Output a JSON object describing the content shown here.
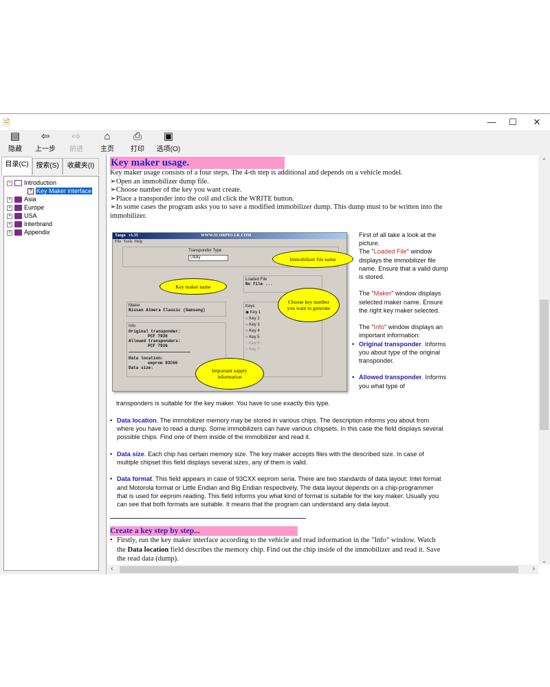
{
  "window": {
    "minimize": "—",
    "maximize": "☐",
    "close": "✕"
  },
  "toolbar": [
    {
      "label": "隐藏",
      "icon": "hide-icon",
      "glyph": "▤"
    },
    {
      "label": "上一步",
      "icon": "back-arrow-icon",
      "glyph": "⇦"
    },
    {
      "label": "前进",
      "icon": "forward-arrow-icon",
      "glyph": "⇨",
      "disabled": true
    },
    {
      "label": "主页",
      "icon": "home-icon",
      "glyph": "⌂"
    },
    {
      "label": "打印",
      "icon": "printer-icon",
      "glyph": "⎙"
    },
    {
      "label": "选项(O)",
      "icon": "options-icon",
      "glyph": "▣"
    }
  ],
  "tabs": [
    "目录(C)",
    "搜索(S)",
    "收藏夹(I)"
  ],
  "tree": [
    {
      "label": "Introduction",
      "expanded": true
    },
    {
      "label": "Key Maker interface",
      "selected": true
    },
    {
      "label": "Asia"
    },
    {
      "label": "Europe"
    },
    {
      "label": "USA"
    },
    {
      "label": "Interbrand"
    },
    {
      "label": "Appendix"
    }
  ],
  "content": {
    "title": "Key maker usage.",
    "intro": "Key maker usage consists of a four steps. The 4-th step is additional and depends on a vehicle model.",
    "steps": [
      "Open an immobilizer dump file.",
      "Choose number of the key you want create.",
      "Place a transponder into the coil and click the WRITE button.",
      "In some cases the program asks you to save a modified immobilizer dump. This dump must to be written into the immobilizer."
    ],
    "screenshot": {
      "app": "Tango",
      "version": "v1.35",
      "site": "WWW.SCORPIO-LK.COM",
      "menu": [
        "File",
        "Tools",
        "Help"
      ],
      "transponder_type_label": "Transponder Type",
      "transponder_type_value": "Utility",
      "loaded_file_label": "Loaded File",
      "loaded_file_value": "No file ...",
      "maker_label": "Maker",
      "maker_value": "Nissan Almera Classic (Samsung)",
      "info_label": "Info",
      "info_lines": [
        "Original transponder:",
        "PCF 7936",
        "Allowed transponders:",
        "PCF 7936",
        "Data location:",
        "eeprom 93C66",
        "Data size:"
      ],
      "keys_label": "Keys",
      "keys": [
        "Key 1",
        "Key 2",
        "Key 3",
        "Key 4",
        "Key 5",
        "Key 6",
        "Key 7"
      ],
      "bubbles": [
        "Immobilizer file name",
        "Key maker name",
        "Choose key number you want to generate",
        "Important supply information"
      ]
    },
    "side": {
      "p1": "First of all take a look at the picture.",
      "p2a": "The \"",
      "p2b": "Loaded File",
      "p2c": "\" window displays the immobilizer file name. Ensure that a valid dump is stored.",
      "p3a": "The \"",
      "p3b": "Maker",
      "p3c": "\" window displays selected maker name. Ensure the right key maker selected.",
      "p4a": "The \"",
      "p4b": "Info",
      "p4c": "\" window displays an important information:",
      "b1t": "Original transponder",
      "b1": ". Informs you about type of the original transponder.",
      "b2t": "Allowed transponder",
      "b2": ". Informs you what type of"
    },
    "cont": "transponders is suitable for the key maker. You have to use exactly this type.",
    "bullets": [
      {
        "term": "Data location",
        "text": ". The immobilizer memory may be stored in various chips. The description informs you about from where you have to read a dump. Some immobilizers can have various chipsets. In this case the field displays several possible chips. Find one of them inside of the immobilizer and read it."
      },
      {
        "term": "Data size",
        "text": ". Each chip has certain memory size. The key maker accepts files with the described size. In case of multiple chipset this field displays several sizes, any of them is valid."
      },
      {
        "term": "Data format",
        "text": ". This field appears in case of 93CXX eeprom seria. There are two standards of data layout: Intel format and Motorola format or Little Endian and Big Endian respectively. The data layout depends on a chip-programmer that is used for eeprom reading. This field informs you what kind of format is suitable for the key maker. Usually you can see that both formats are suitable. It means that the program can understand any data layout."
      }
    ],
    "section2": "Create a key step by step...",
    "s2a": "Firstly, run the key maker interface according to the vehicle and read information in the \"Info\" window. Watch the ",
    "s2b": "Data location",
    "s2c": " field describes the memory chip. Find out the chip inside of the immobilizer and read it. Save the read data (dump)."
  },
  "colors": {
    "heading_bg": "#ff99cc",
    "heading_text": "#2222cc",
    "term": "#2222aa",
    "highlight": "#cc2222",
    "bubble": "#ffff00"
  }
}
